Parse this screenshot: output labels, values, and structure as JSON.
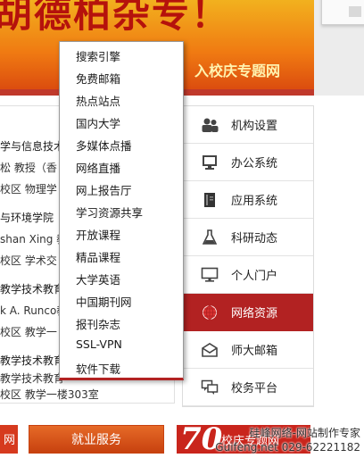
{
  "banner": {
    "headline": "胡德柏杂专！",
    "subtitle": "入校庆专题网"
  },
  "news": {
    "lines": [
      "学与信息技术",
      "松 教授（香",
      "校区 物理学",
      "与环境学院",
      "shan Xing 教",
      "校区 学术交",
      "教学技术教育",
      "k A. Runco教",
      "校区 教学一",
      "教学技术教育",
      "教学技术教育",
      "校区 教学一楼303室"
    ]
  },
  "dropdown": {
    "items": [
      "搜索引擎",
      "免费邮箱",
      "热点站点",
      "国内大学",
      "多媒体点播",
      "网络直播",
      "网上报告厅",
      "学习资源共享",
      "开放课程",
      "精品课程",
      "大学英语",
      "中国期刊网",
      "报刊杂志",
      "SSL-VPN",
      "软件下载"
    ]
  },
  "sidebar": {
    "items": [
      {
        "label": "机构设置",
        "icon": "people-icon"
      },
      {
        "label": "办公系统",
        "icon": "monitor-icon"
      },
      {
        "label": "应用系统",
        "icon": "book-icon"
      },
      {
        "label": "科研动态",
        "icon": "flask-icon"
      },
      {
        "label": "个人门户",
        "icon": "display-icon"
      },
      {
        "label": "网络资源",
        "icon": "globe-icon"
      },
      {
        "label": "师大邮箱",
        "icon": "mail-icon"
      },
      {
        "label": "校务平台",
        "icon": "chat-icon"
      }
    ],
    "active_color": "#b22222"
  },
  "bottom": {
    "left_text": "网",
    "service_label": "就业服务",
    "anniv_number": "70",
    "anniv_text": "校庆专题网"
  },
  "watermark": {
    "line1": "硅峰网络-网站制作专家",
    "line2": "Guifeng.net 029-62221182"
  }
}
